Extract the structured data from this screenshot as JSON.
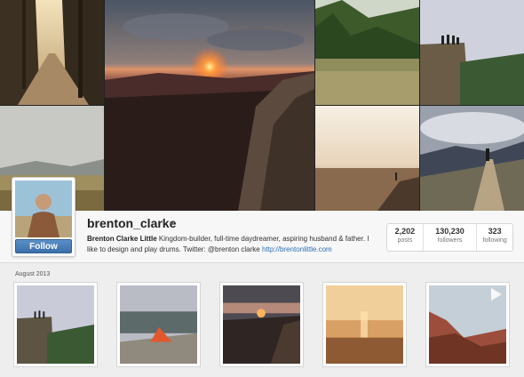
{
  "profile": {
    "username": "brenton_clarke",
    "dropdown_icon": "caret-down-icon",
    "full_name": "Brenton Clarke Little",
    "bio": " Kingdom-builder, full-time daydreamer, aspiring husband & father. I like to design and play drums. Twitter: @brenton  clarke ",
    "website": "http://brentonlittle.com",
    "follow_label": "Follow"
  },
  "stats": [
    {
      "value": "2,202",
      "label": "posts"
    },
    {
      "value": "130,230",
      "label": "followers"
    },
    {
      "value": "323",
      "label": "following"
    }
  ],
  "feed": {
    "month_label": "August 2013",
    "video_icon": "play-icon"
  },
  "colors": {
    "follow_button": "#4a7fba",
    "link": "#2b6fb6",
    "background": "#eeeeee"
  }
}
